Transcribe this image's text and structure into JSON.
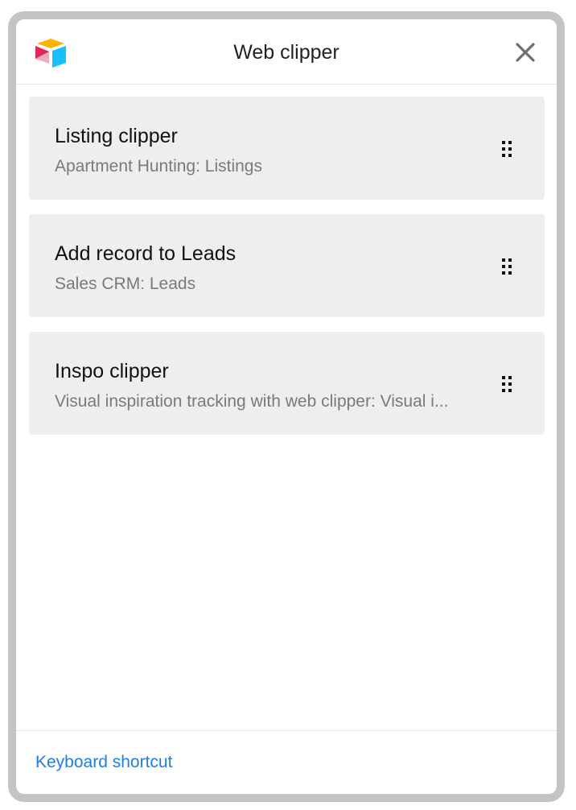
{
  "header": {
    "title": "Web clipper",
    "logo_icon": "airtable-logo-icon",
    "close_icon": "close-icon"
  },
  "clippers": [
    {
      "title": "Listing clipper",
      "subtitle": "Apartment Hunting: Listings"
    },
    {
      "title": "Add record to Leads",
      "subtitle": "Sales CRM: Leads"
    },
    {
      "title": "Inspo clipper",
      "subtitle": "Visual inspiration tracking with web clipper: Visual i..."
    }
  ],
  "footer": {
    "keyboard_shortcut_label": "Keyboard shortcut"
  },
  "colors": {
    "frame_border": "#c4c4c4",
    "card_background": "#eeeeee",
    "link": "#1f7ce8",
    "subtitle": "#7a7a7a"
  }
}
